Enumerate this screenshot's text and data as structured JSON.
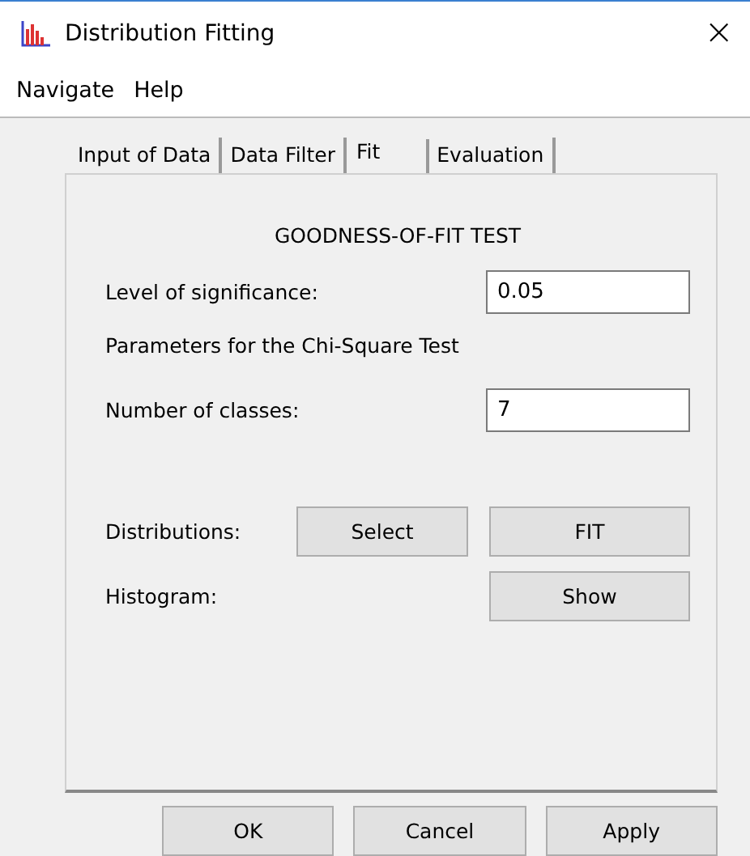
{
  "window": {
    "title": "Distribution Fitting",
    "close": "×"
  },
  "menu": [
    "Navigate",
    "Help"
  ],
  "tabs": [
    {
      "label": "Input of Data",
      "selected": false
    },
    {
      "label": "Data Filter",
      "selected": false
    },
    {
      "label": "Fit",
      "selected": true
    },
    {
      "label": "Evaluation",
      "selected": false
    }
  ],
  "panel": {
    "heading": "GOODNESS-OF-FIT TEST",
    "significance": {
      "label": "Level of significance:",
      "value": "0.05"
    },
    "chi_square_heading": "Parameters for the Chi-Square Test",
    "classes": {
      "label": "Number of classes:",
      "value": "7"
    },
    "distributions": {
      "label": "Distributions:",
      "buttons": [
        "Select",
        "FIT"
      ]
    },
    "histogram": {
      "label": "Histogram:",
      "button": "Show"
    }
  },
  "buttons": [
    "OK",
    "Cancel",
    "Apply"
  ]
}
